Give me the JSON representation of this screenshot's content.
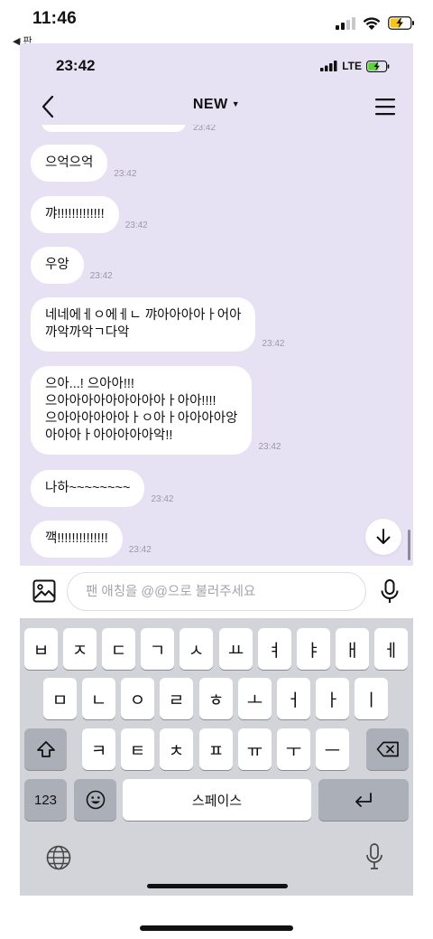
{
  "outer_status": {
    "time": "11:46",
    "back_label": "◀ 판",
    "battery_color": "#f5c518"
  },
  "inner_status": {
    "time": "23:42",
    "network": "LTE",
    "battery_color": "#5ad33a"
  },
  "header": {
    "title": "NEW",
    "back_icon": "chevron-left-icon",
    "menu_icon": "hamburger-menu-icon"
  },
  "chat": {
    "partial_time": "23:42",
    "messages": [
      {
        "text": "으억으억",
        "time": "23:42"
      },
      {
        "text": "꺄!!!!!!!!!!!!!",
        "time": "23:42"
      },
      {
        "text": "우앙",
        "time": "23:42"
      },
      {
        "text": "네네에ㅔㅇ에ㅔㄴ 꺄아아아아ㅏ어아\n까악까악ㄱ다악",
        "time": "23:42"
      },
      {
        "text": "으아...! 으아아!!!\n으아아아아아아아아아ㅏ아아!!!!\n으아아아아아아ㅏㅇ아ㅏ아아아아앙\n아아아ㅏ아아아아아악!!",
        "time": "23:42"
      },
      {
        "text": "나하~~~~~~~~",
        "time": "23:42"
      },
      {
        "text": "깩!!!!!!!!!!!!!!",
        "time": "23:42"
      }
    ]
  },
  "composer": {
    "placeholder": "팬 애칭을 @@으로 불러주세요",
    "value": ""
  },
  "keyboard": {
    "row1": [
      "ㅂ",
      "ㅈ",
      "ㄷ",
      "ㄱ",
      "ㅅ",
      "ㅛ",
      "ㅕ",
      "ㅑ",
      "ㅐ",
      "ㅔ"
    ],
    "row2": [
      "ㅁ",
      "ㄴ",
      "ㅇ",
      "ㄹ",
      "ㅎ",
      "ㅗ",
      "ㅓ",
      "ㅏ",
      "ㅣ"
    ],
    "row3": [
      "ㅋ",
      "ㅌ",
      "ㅊ",
      "ㅍ",
      "ㅠ",
      "ㅜ",
      "ㅡ"
    ],
    "numbers_label": "123",
    "space_label": "스페이스",
    "shift_icon": "shift-icon",
    "delete_icon": "delete-icon",
    "emoji_icon": "emoji-icon",
    "return_icon": "return-icon",
    "globe_icon": "globe-icon",
    "dictation_icon": "microphone-icon"
  }
}
